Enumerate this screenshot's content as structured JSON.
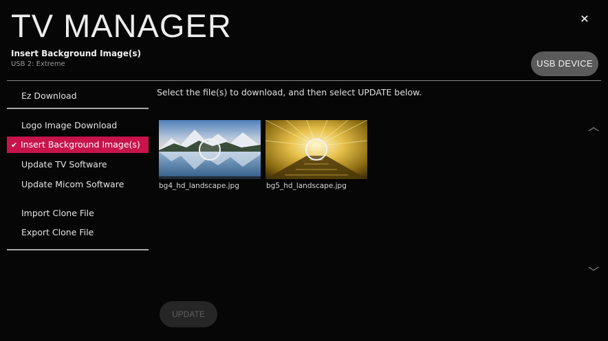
{
  "header": {
    "title": "TV MANAGER",
    "subtitle": "Insert Background Image(s)",
    "source": "USB 2: Extreme",
    "close_glyph": "✕",
    "usb_button": "USB DEVICE"
  },
  "sidebar": {
    "items": [
      {
        "label": "Ez Download",
        "selected": false
      },
      {
        "label": "Logo Image Download",
        "selected": false
      },
      {
        "label": "Insert Background Image(s)",
        "selected": true
      },
      {
        "label": "Update TV Software",
        "selected": false
      },
      {
        "label": "Update Micom Software",
        "selected": false
      },
      {
        "label": "Import Clone File",
        "selected": false
      },
      {
        "label": "Export Clone File",
        "selected": false
      }
    ],
    "selected_glyph": "✔"
  },
  "main": {
    "instruction": "Select the file(s) to download, and then select UPDATE below.",
    "files": [
      {
        "name": "bg4_hd_landscape.jpg",
        "icon": "mountain-lake-thumbnail"
      },
      {
        "name": "bg5_hd_landscape.jpg",
        "icon": "tunnel-light-thumbnail"
      }
    ],
    "scroll_up_glyph": "︿",
    "scroll_down_glyph": "﹀",
    "update_button": "UPDATE"
  },
  "colors": {
    "accent": "#c8134b",
    "background": "#060606",
    "button": "#5a5a5a",
    "disabled_button": "#262626"
  }
}
